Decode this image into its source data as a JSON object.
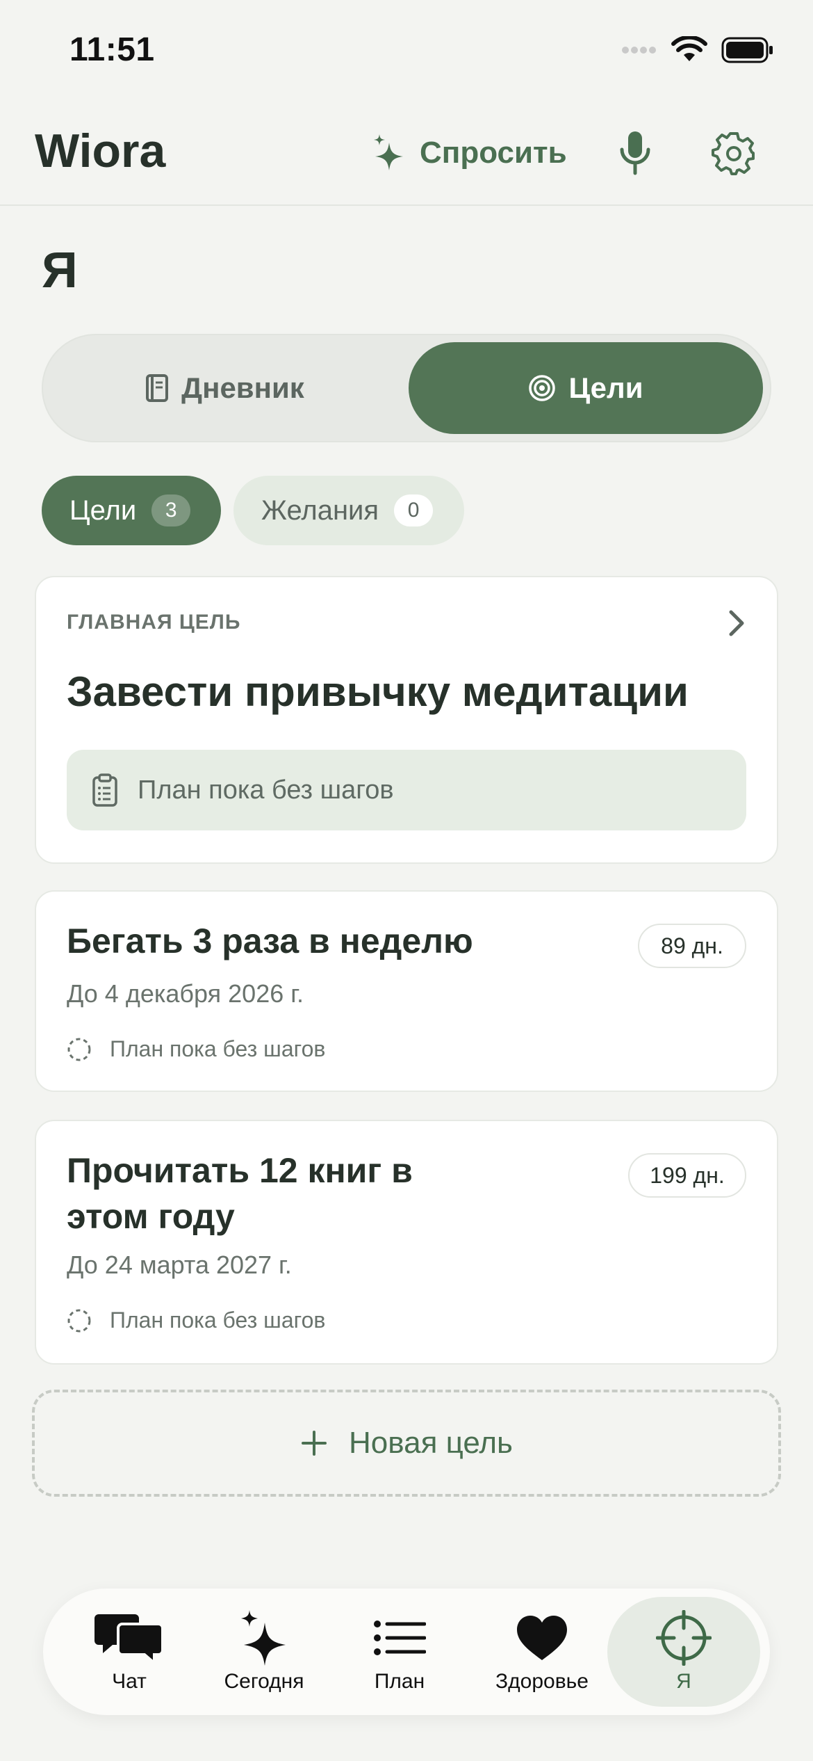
{
  "status": {
    "time": "11:51"
  },
  "header": {
    "title": "Wiora",
    "ask_label": "Спросить"
  },
  "page": {
    "title": "Я"
  },
  "segment": {
    "left_label": "Дневник",
    "right_label": "Цели",
    "selected": "Цели"
  },
  "chips": [
    {
      "label": "Цели",
      "count": "3",
      "active": true
    },
    {
      "label": "Желания",
      "count": "0",
      "active": false
    }
  ],
  "main_goal": {
    "section_label": "ГЛАВНАЯ ЦЕЛЬ",
    "title": "Завести привычку медитации",
    "plan_text": "План пока без шагов"
  },
  "goals": [
    {
      "title": "Бегать 3 раза в неделю",
      "date": "До 4 декабря 2026 г.",
      "days": "89 дн.",
      "plan": "План пока без шагов"
    },
    {
      "title_line1": "Прочитать 12 книг в",
      "title_line2": "этом году",
      "date": "До 24 марта 2027 г.",
      "days": "199 дн.",
      "plan": "План пока без шагов"
    }
  ],
  "new_goal_label": "Новая цель",
  "tabs": [
    {
      "label": "Чат",
      "icon": "chat-bubbles-icon"
    },
    {
      "label": "Сегодня",
      "icon": "sparkles-icon"
    },
    {
      "label": "План",
      "icon": "list-icon"
    },
    {
      "label": "Здоровье",
      "icon": "heart-icon"
    },
    {
      "label": "Я",
      "icon": "crosshair-icon",
      "active": true
    }
  ],
  "colors": {
    "accent": "#537556",
    "background": "#f3f4f1",
    "text": "#27312a"
  }
}
